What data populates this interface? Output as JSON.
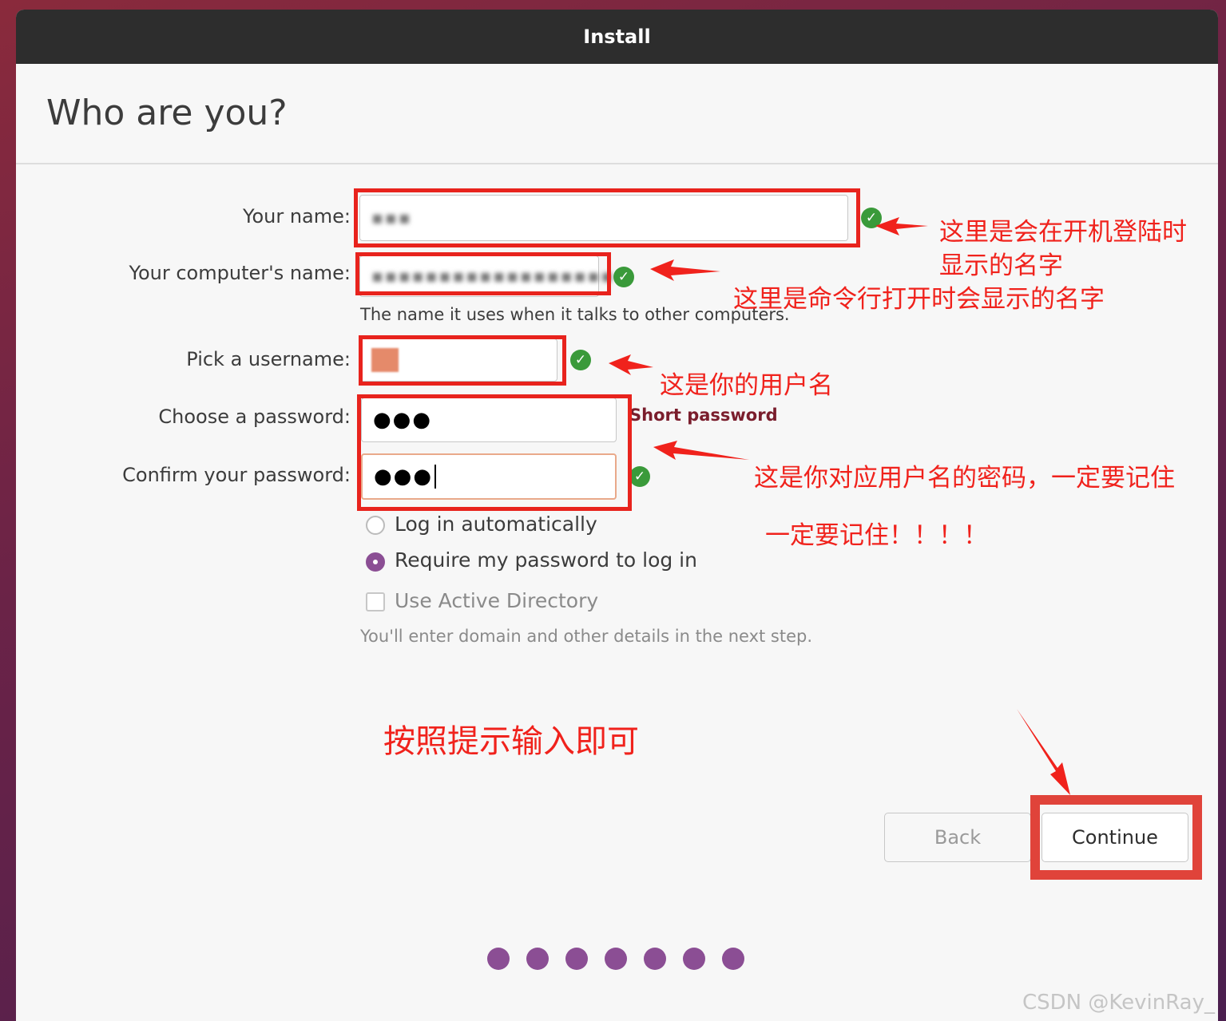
{
  "window": {
    "title": "Install"
  },
  "page": {
    "title": "Who are you?"
  },
  "form": {
    "name_label": "Your name:",
    "name_value": "▪▪▪",
    "computer_label": "Your computer's name:",
    "computer_value": "▪▪▪▪▪▪▪▪▪▪▪▪▪▪▪▪▪▪",
    "computer_hint": "The name it uses when it talks to other computers.",
    "username_label": "Pick a username:",
    "password_label": "Choose a password:",
    "password_value": "●●●",
    "password_warning": "Short password",
    "confirm_label": "Confirm your password:",
    "confirm_value": "●●●"
  },
  "options": {
    "auto_login": "Log in automatically",
    "require_password": "Require my password to log in",
    "active_directory": "Use Active Directory",
    "ad_hint": "You'll enter domain and other details in the next step."
  },
  "buttons": {
    "back": "Back",
    "continue": "Continue"
  },
  "annotations": {
    "name_note_1": "这里是会在开机登陆时",
    "name_note_2": "显示的名字",
    "computer_note": "这里是命令行打开时会显示的名字",
    "username_note": "这是你的用户名",
    "password_note": "这是你对应用户名的密码，一定要记住",
    "password_note_2": "一定要记住！！！！",
    "bottom_note": "按照提示输入即可"
  },
  "watermark": "CSDN @KevinRay_",
  "colors": {
    "titlebar": "#2d2d2d",
    "accent": "#8b4e94",
    "annotation": "#f0221c",
    "check": "#3a9a3a"
  }
}
